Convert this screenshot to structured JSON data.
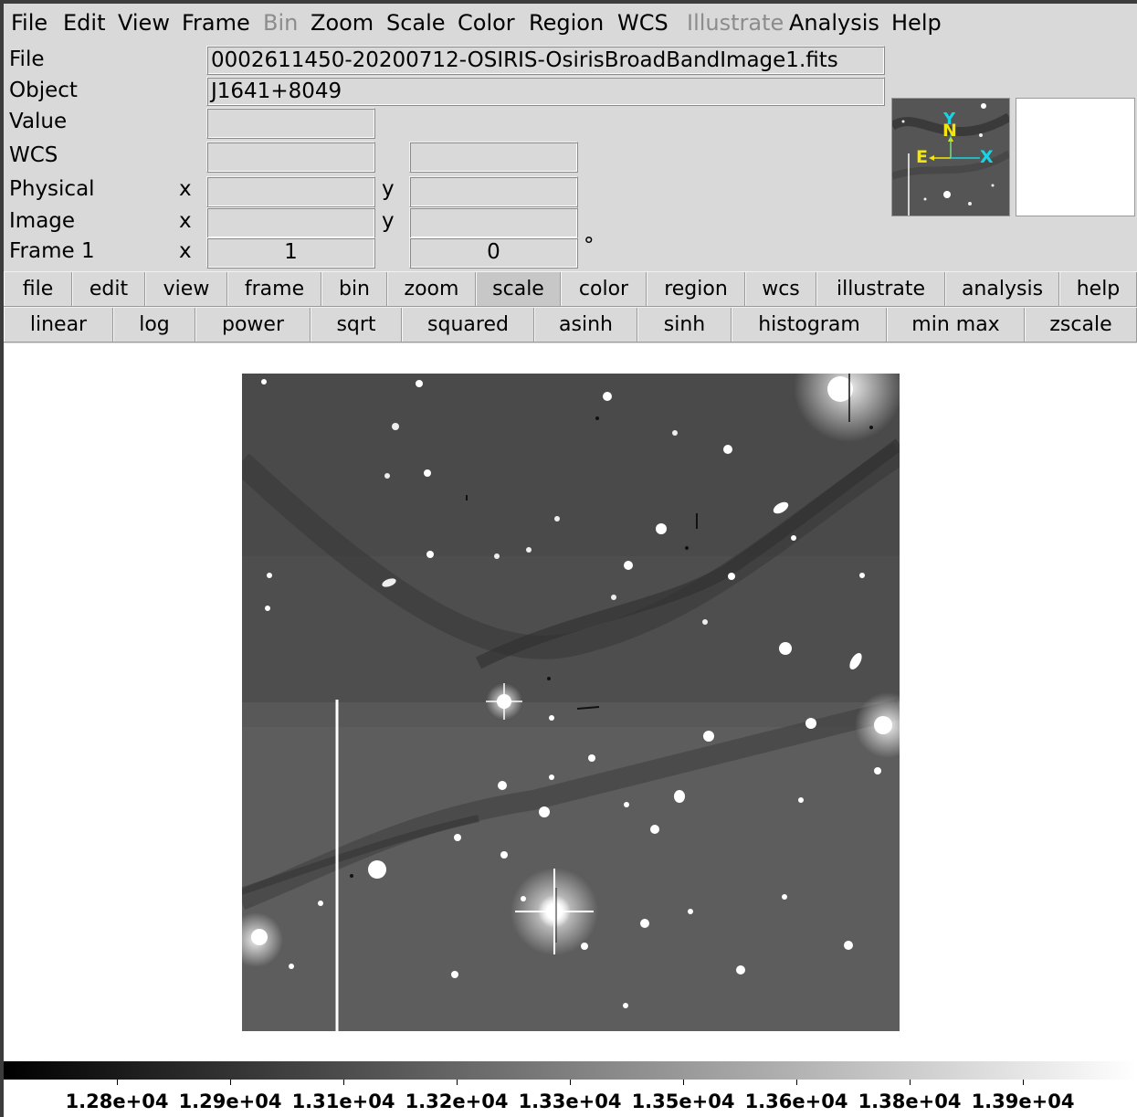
{
  "menubar": {
    "items": [
      {
        "label": "File",
        "enabled": true
      },
      {
        "label": "Edit",
        "enabled": true
      },
      {
        "label": "View",
        "enabled": true
      },
      {
        "label": "Frame",
        "enabled": true
      },
      {
        "label": "Bin",
        "enabled": false
      },
      {
        "label": "Zoom",
        "enabled": true
      },
      {
        "label": "Scale",
        "enabled": true
      },
      {
        "label": "Color",
        "enabled": true
      },
      {
        "label": "Region",
        "enabled": true
      },
      {
        "label": "WCS",
        "enabled": true
      },
      {
        "label": "Illustrate",
        "enabled": false
      },
      {
        "label": "Analysis",
        "enabled": true
      },
      {
        "label": "Help",
        "enabled": true
      }
    ]
  },
  "info": {
    "file_label": "File",
    "file_value": "0002611450-20200712-OSIRIS-OsirisBroadBandImage1.fits",
    "object_label": "Object",
    "object_value": "J1641+8049",
    "value_label": "Value",
    "value_value": "",
    "wcs_label": "WCS",
    "wcs_value1": "",
    "wcs_value2": "",
    "physical_label": "Physical",
    "physical_x_label": "x",
    "physical_y_label": "y",
    "physical_x": "",
    "physical_y": "",
    "image_label": "Image",
    "image_x_label": "x",
    "image_y_label": "y",
    "image_x": "",
    "image_y": "",
    "frame_label": "Frame 1",
    "frame_x_label": "x",
    "frame_x": "1",
    "frame_y": "0",
    "frame_unit": "°"
  },
  "panner": {
    "compass_n": "N",
    "compass_e": "E",
    "axis_x": "X",
    "axis_y": "Y",
    "compass_color_ne": "#f5e60a",
    "axis_color_xy": "#16d6e6"
  },
  "buttonbar": {
    "items": [
      "file",
      "edit",
      "view",
      "frame",
      "bin",
      "zoom",
      "scale",
      "color",
      "region",
      "wcs",
      "illustrate",
      "analysis",
      "help"
    ],
    "active": "scale"
  },
  "scalebar": {
    "items": [
      "linear",
      "log",
      "power",
      "sqrt",
      "squared",
      "asinh",
      "sinh",
      "histogram",
      "min max",
      "zscale"
    ]
  },
  "colorbar": {
    "ticks": [
      "1.28e+04",
      "1.29e+04",
      "1.31e+04",
      "1.32e+04",
      "1.33e+04",
      "1.35e+04",
      "1.36e+04",
      "1.38e+04",
      "1.39e+04"
    ]
  }
}
